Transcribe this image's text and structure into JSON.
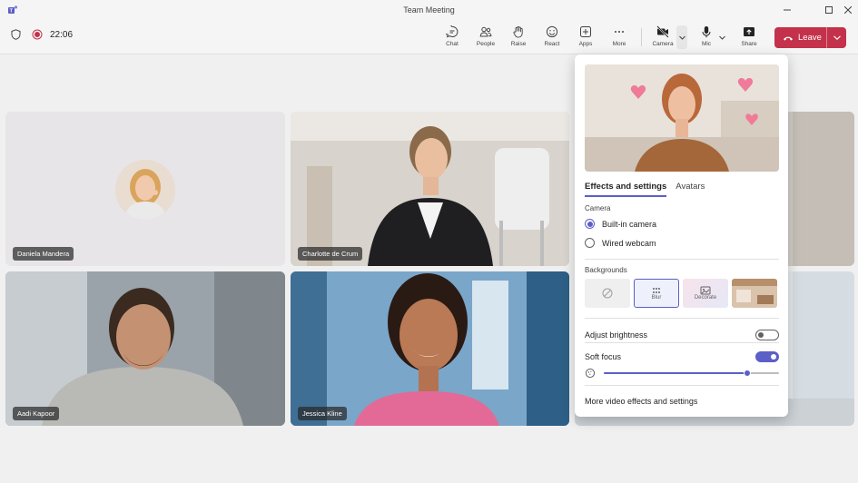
{
  "window": {
    "title": "Team Meeting"
  },
  "toolbar": {
    "timer": "22:06",
    "buttons": [
      {
        "label": "Chat",
        "icon": "chat-icon"
      },
      {
        "label": "People",
        "icon": "people-icon"
      },
      {
        "label": "Raise",
        "icon": "raise-hand-icon"
      },
      {
        "label": "React",
        "icon": "react-emoji-icon"
      },
      {
        "label": "Apps",
        "icon": "apps-icon"
      },
      {
        "label": "More",
        "icon": "more-icon"
      },
      {
        "label": "Camera",
        "icon": "camera-off-icon"
      },
      {
        "label": "Mic",
        "icon": "mic-icon"
      },
      {
        "label": "Share",
        "icon": "share-icon"
      }
    ],
    "leave_label": "Leave"
  },
  "participants": [
    {
      "name": "Daniela Mandera"
    },
    {
      "name": "Charlotte de Crum"
    },
    {
      "name": "Aadi Kapoor"
    },
    {
      "name": "Jessica Kline"
    }
  ],
  "panel": {
    "tabs": [
      "Effects and settings",
      "Avatars"
    ],
    "camera_section": "Camera",
    "camera_options": [
      "Built-in camera",
      "Wired webcam"
    ],
    "selected_camera": "Built-in camera",
    "backgrounds_section": "Backgrounds",
    "backgrounds": [
      {
        "label": "",
        "icon": "none-icon"
      },
      {
        "label": "Blur",
        "icon": "blur-icon"
      },
      {
        "label": "Decorate",
        "icon": "decorate-icon"
      },
      {
        "label": "",
        "icon": "room-image"
      }
    ],
    "adjust_brightness": {
      "label": "Adjust brightness",
      "on": false
    },
    "soft_focus": {
      "label": "Soft focus",
      "on": true,
      "level": 0.82
    },
    "more_link": "More video effects and settings"
  },
  "colors": {
    "accent": "#5b5fc7",
    "leave": "#c4314b"
  }
}
